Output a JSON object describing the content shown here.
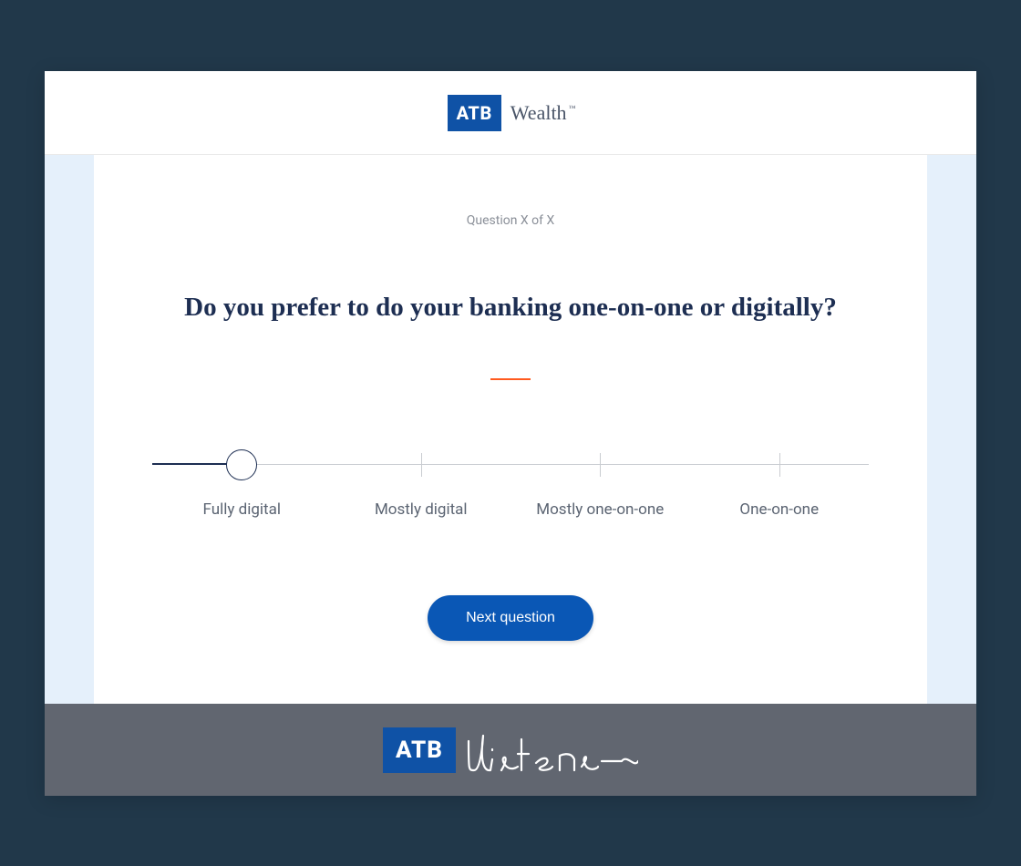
{
  "header": {
    "logo_abbrev": "ATB",
    "logo_word": "Wealth"
  },
  "survey": {
    "counter": "Question X of X",
    "question": "Do you prefer to do your banking one-on-one or digitally?",
    "options": [
      "Fully digital",
      "Mostly digital",
      "Mostly one-on-one",
      "One-on-one"
    ],
    "selected_index": 0,
    "next_label": "Next question"
  },
  "footer": {
    "logo_abbrev": "ATB",
    "script_word": "listens"
  },
  "colors": {
    "brand_blue": "#0f52a6",
    "button_blue": "#0a57b5",
    "heading_navy": "#1d2e52",
    "accent_orange": "#ff5a1f",
    "page_bg": "#21384a",
    "body_tint": "#e5f0fb",
    "footer_grey": "#616670"
  }
}
